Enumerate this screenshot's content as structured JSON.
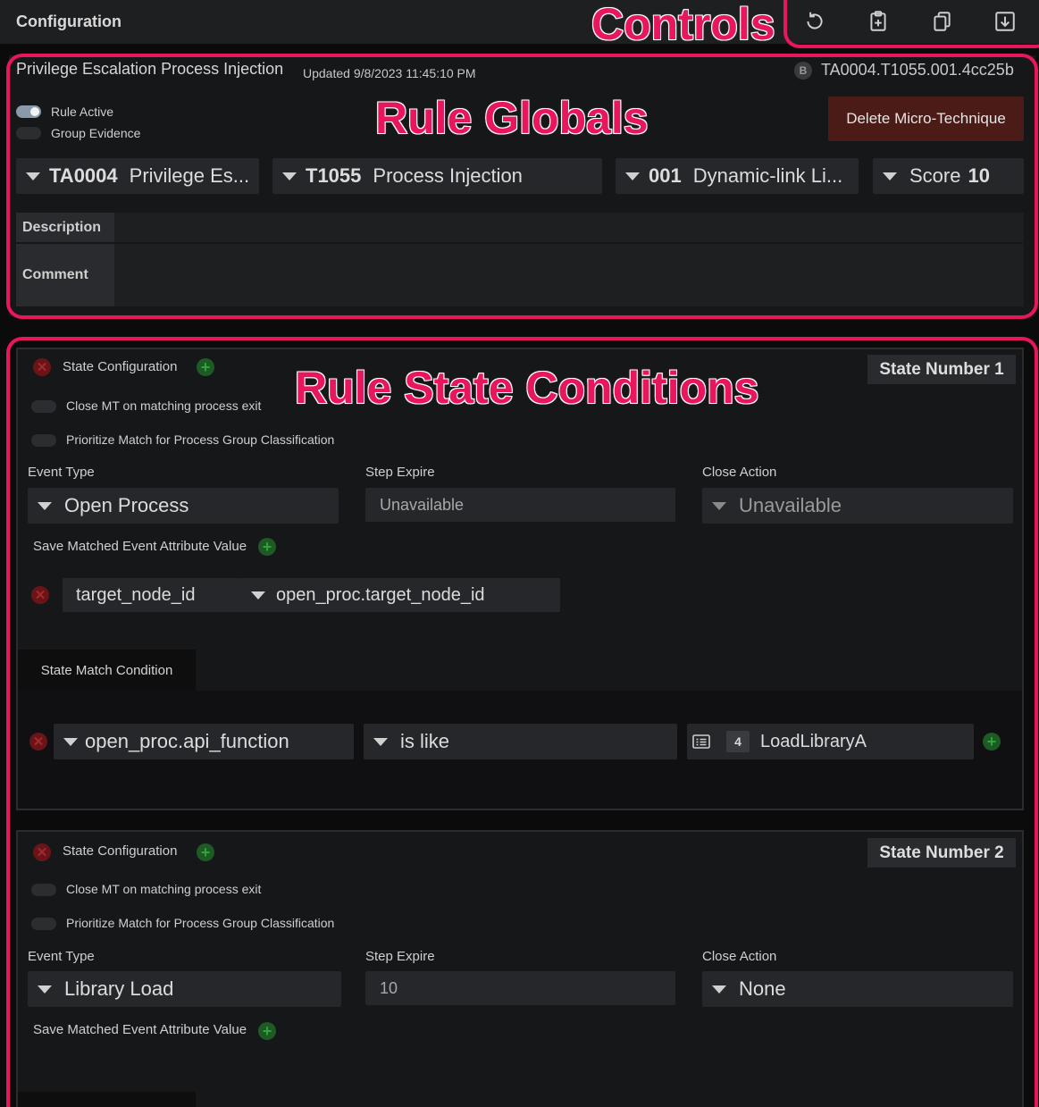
{
  "header": {
    "title": "Configuration",
    "controls": [
      {
        "name": "refresh-icon"
      },
      {
        "name": "paste-add-icon"
      },
      {
        "name": "copy-icon"
      },
      {
        "name": "download-icon"
      }
    ]
  },
  "annotations": {
    "controls": "Controls",
    "rule_globals": "Rule Globals",
    "rule_state_conditions": "Rule State Conditions",
    "color": "#e8175d"
  },
  "rule": {
    "name": "Privilege Escalation Process Injection",
    "updated": "Updated 9/8/2023 11:45:10 PM",
    "badge": "B",
    "id": "TA0004.T1055.001.4cc25b",
    "toggles": {
      "rule_active": {
        "label": "Rule Active",
        "on": true
      },
      "group_evidence": {
        "label": "Group Evidence",
        "on": false
      }
    },
    "delete_label": "Delete Micro-Technique",
    "tactic": {
      "code": "TA0004",
      "name": "Privilege Es..."
    },
    "technique": {
      "code": "T1055",
      "name": "Process Injection"
    },
    "subtechnique": {
      "code": "001",
      "name": "Dynamic-link Li..."
    },
    "score": {
      "label": "Score",
      "value": "10"
    },
    "description_label": "Description",
    "description_value": "",
    "comment_label": "Comment",
    "comment_value": ""
  },
  "states": [
    {
      "config_label": "State Configuration",
      "state_number_label": "State Number 1",
      "close_mt_label": "Close MT on matching process exit",
      "prioritize_label": "Prioritize Match for Process Group Classification",
      "event_type_label": "Event Type",
      "event_type": "Open Process",
      "step_expire_label": "Step Expire",
      "step_expire": "Unavailable",
      "close_action_label": "Close Action",
      "close_action": "Unavailable",
      "save_attr_label": "Save Matched Event Attribute Value",
      "saved_attr_name": "target_node_id",
      "saved_attr_source": "open_proc.target_node_id",
      "match_tab_label": "State Match Condition",
      "condition": {
        "field": "open_proc.api_function",
        "operator": "is like",
        "value_count": "4",
        "value": "LoadLibraryA"
      }
    },
    {
      "config_label": "State Configuration",
      "state_number_label": "State Number 2",
      "close_mt_label": "Close MT on matching process exit",
      "prioritize_label": "Prioritize Match for Process Group Classification",
      "event_type_label": "Event Type",
      "event_type": "Library Load",
      "step_expire_label": "Step Expire",
      "step_expire": "10",
      "close_action_label": "Close Action",
      "close_action": "None",
      "save_attr_label": "Save Matched Event Attribute Value"
    }
  ]
}
